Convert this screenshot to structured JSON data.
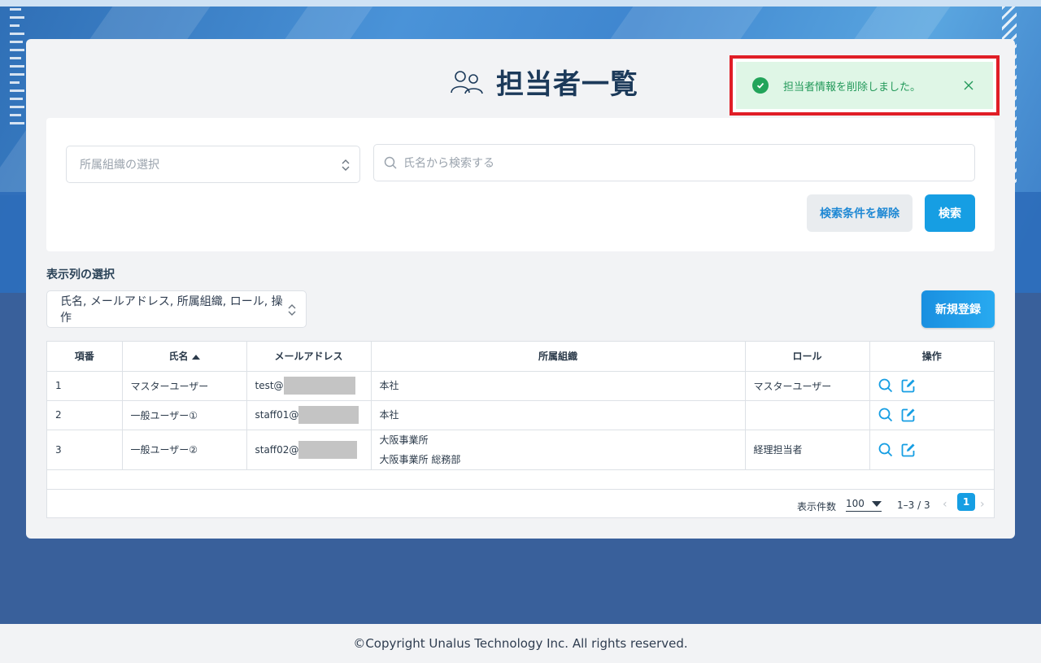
{
  "page": {
    "title": "担当者一覧"
  },
  "toast": {
    "message": "担当者情報を削除しました。"
  },
  "search": {
    "org_placeholder": "所属組織の選択",
    "name_placeholder": "氏名から検索する",
    "clear_label": "検索条件を解除",
    "search_label": "検索"
  },
  "columns_select": {
    "label": "表示列の選択",
    "value": "氏名, メールアドレス, 所属組織, ロール, 操作"
  },
  "new_button": "新規登録",
  "table": {
    "headers": [
      "項番",
      "氏名",
      "メールアドレス",
      "所属組織",
      "ロール",
      "操作"
    ],
    "rows": [
      {
        "no": "1",
        "name": "マスターユーザー",
        "email": "test@",
        "org": [
          "本社"
        ],
        "role": "マスターユーザー"
      },
      {
        "no": "2",
        "name": "一般ユーザー①",
        "email": "staff01@",
        "org": [
          "本社"
        ],
        "role": ""
      },
      {
        "no": "3",
        "name": "一般ユーザー②",
        "email": "staff02@",
        "org": [
          "大阪事業所",
          "大阪事業所 総務部"
        ],
        "role": "経理担当者"
      }
    ]
  },
  "pagination": {
    "per_page_label": "表示件数",
    "per_page": "100",
    "range": "1–3 / 3",
    "current_page": "1"
  },
  "footer": "©Copyright Unalus Technology Inc. All rights reserved.",
  "colors": {
    "primary": "#169ee3",
    "toast_bg": "#dff6e6",
    "toast_text": "#23995a",
    "highlight_border": "#e01e26"
  }
}
